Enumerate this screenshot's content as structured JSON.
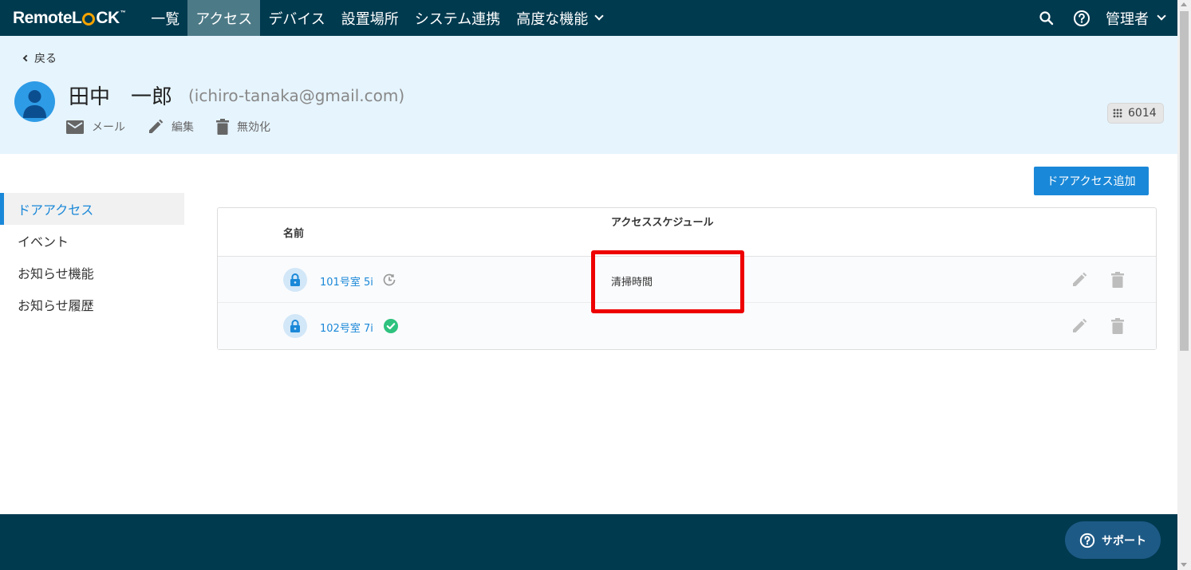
{
  "app": {
    "brand": "RemoteL",
    "brand_suffix": "CK",
    "brand_tm": "™"
  },
  "nav": {
    "items": [
      {
        "label": "一覧"
      },
      {
        "label": "アクセス"
      },
      {
        "label": "デバイス"
      },
      {
        "label": "設置場所"
      },
      {
        "label": "システム連携"
      },
      {
        "label": "高度な機能"
      }
    ],
    "admin_label": "管理者"
  },
  "header": {
    "back_label": "戻る",
    "user_name": "田中　一郎",
    "user_email": "(ichiro-tanaka@gmail.com)",
    "actions": {
      "mail": "メール",
      "edit": "編集",
      "disable": "無効化"
    },
    "pin": "6014"
  },
  "sidebar": {
    "items": [
      {
        "label": "ドアアクセス"
      },
      {
        "label": "イベント"
      },
      {
        "label": "お知らせ機能"
      },
      {
        "label": "お知らせ履歴"
      }
    ]
  },
  "main": {
    "add_button": "ドアアクセス追加",
    "columns": {
      "name": "名前",
      "schedule": "アクセススケジュール"
    },
    "rows": [
      {
        "name": "101号室 5i",
        "schedule": "清掃時間",
        "status_icon": "clock-icon"
      },
      {
        "name": "102号室 7i",
        "schedule": "",
        "status_icon": "check-circle-icon"
      }
    ]
  },
  "footer": {
    "support_label": "サポート"
  },
  "colors": {
    "nav_bg": "#003a4f",
    "nav_active": "#4d7a87",
    "header_bg": "#e6f4fd",
    "accent": "#1a88d8",
    "highlight": "#ee0000",
    "success": "#2ec27e"
  }
}
